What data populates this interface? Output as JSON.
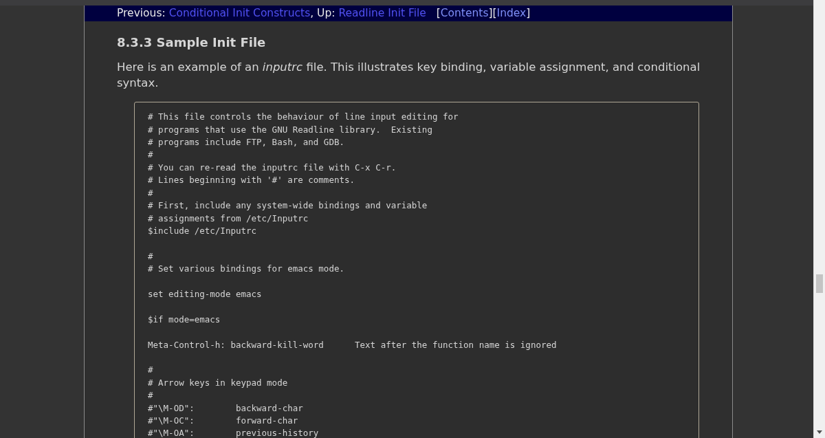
{
  "nav": [
    {
      "kind": "text",
      "text": "Previous: "
    },
    {
      "kind": "link",
      "text": "Conditional Init Constructs",
      "visited": false
    },
    {
      "kind": "text",
      "text": ", Up: "
    },
    {
      "kind": "link",
      "text": "Readline Init File",
      "visited": false
    },
    {
      "kind": "text",
      "text": "   ["
    },
    {
      "kind": "link",
      "text": "Contents",
      "visited": true
    },
    {
      "kind": "text",
      "text": "]["
    },
    {
      "kind": "link",
      "text": "Index",
      "visited": true
    },
    {
      "kind": "text",
      "text": "]"
    }
  ],
  "heading": "8.3.3 Sample Init File",
  "paragraph": "Here is an example of an *inputrc* file. This illustrates key binding, variable assignment, and conditional syntax.",
  "code_blocks": [
    [
      "# This file controls the behaviour of line input editing for",
      "# programs that use the GNU Readline library.  Existing",
      "# programs include FTP, Bash, and GDB.",
      "#",
      "# You can re-read the inputrc file with C-x C-r.",
      "# Lines beginning with '#' are comments.",
      "#",
      "# First, include any system-wide bindings and variable",
      "# assignments from /etc/Inputrc",
      "$include /etc/Inputrc"
    ],
    [
      "#",
      "# Set various bindings for emacs mode."
    ],
    [
      "set editing-mode emacs"
    ],
    [
      "$if mode=emacs"
    ],
    [
      "Meta-Control-h: backward-kill-word      Text after the function name is ignored"
    ],
    [
      "#",
      "# Arrow keys in keypad mode",
      "#",
      "#\"\\M-OD\":        backward-char",
      "#\"\\M-OC\":        forward-char",
      "#\"\\M-OA\":        previous-history"
    ]
  ]
}
